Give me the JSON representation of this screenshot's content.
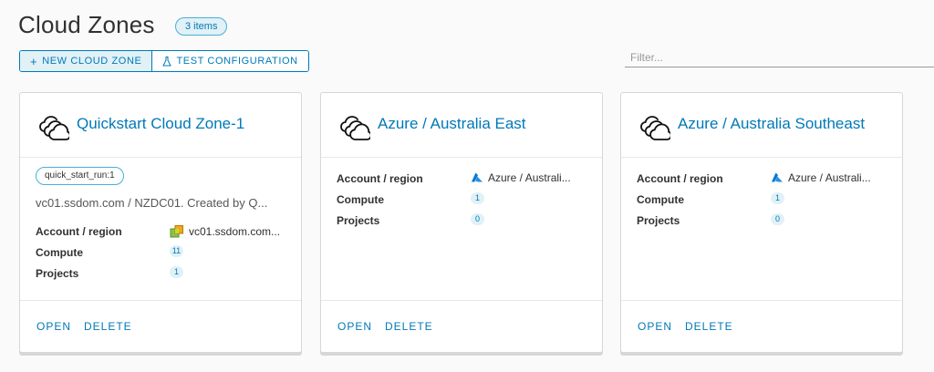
{
  "page": {
    "title": "Cloud Zones",
    "count_badge": "3 items"
  },
  "toolbar": {
    "new_label": "NEW CLOUD ZONE",
    "new_icon": "plus-icon",
    "test_label": "TEST CONFIGURATION",
    "test_icon": "flask-icon"
  },
  "filter": {
    "placeholder": "Filter...",
    "value": ""
  },
  "labels": {
    "account_region": "Account / region",
    "compute": "Compute",
    "projects": "Projects",
    "open": "OPEN",
    "delete": "DELETE"
  },
  "cards": [
    {
      "title": "Quickstart Cloud Zone-1",
      "icon": "cloud-zone-icon",
      "tag": "quick_start_run:1",
      "description": "vc01.ssdom.com / NZDC01. Created by Q...",
      "account_region": "vc01.ssdom.com...",
      "account_icon": "vcenter-icon",
      "compute": "11",
      "projects": "1"
    },
    {
      "title": "Azure / Australia East",
      "icon": "cloud-zone-icon",
      "account_region": "Azure / Australi...",
      "account_icon": "azure-icon",
      "compute": "1",
      "projects": "0"
    },
    {
      "title": "Azure / Australia Southeast",
      "icon": "cloud-zone-icon",
      "account_region": "Azure / Australi...",
      "account_icon": "azure-icon",
      "compute": "1",
      "projects": "0"
    }
  ],
  "colors": {
    "accent": "#0079b8",
    "badge_bg": "#e1f1f6",
    "badge_border": "#49afd9",
    "azure": "#0078d4",
    "vcenter_green": "#8bc34a",
    "vcenter_orange": "#f0a81a"
  }
}
